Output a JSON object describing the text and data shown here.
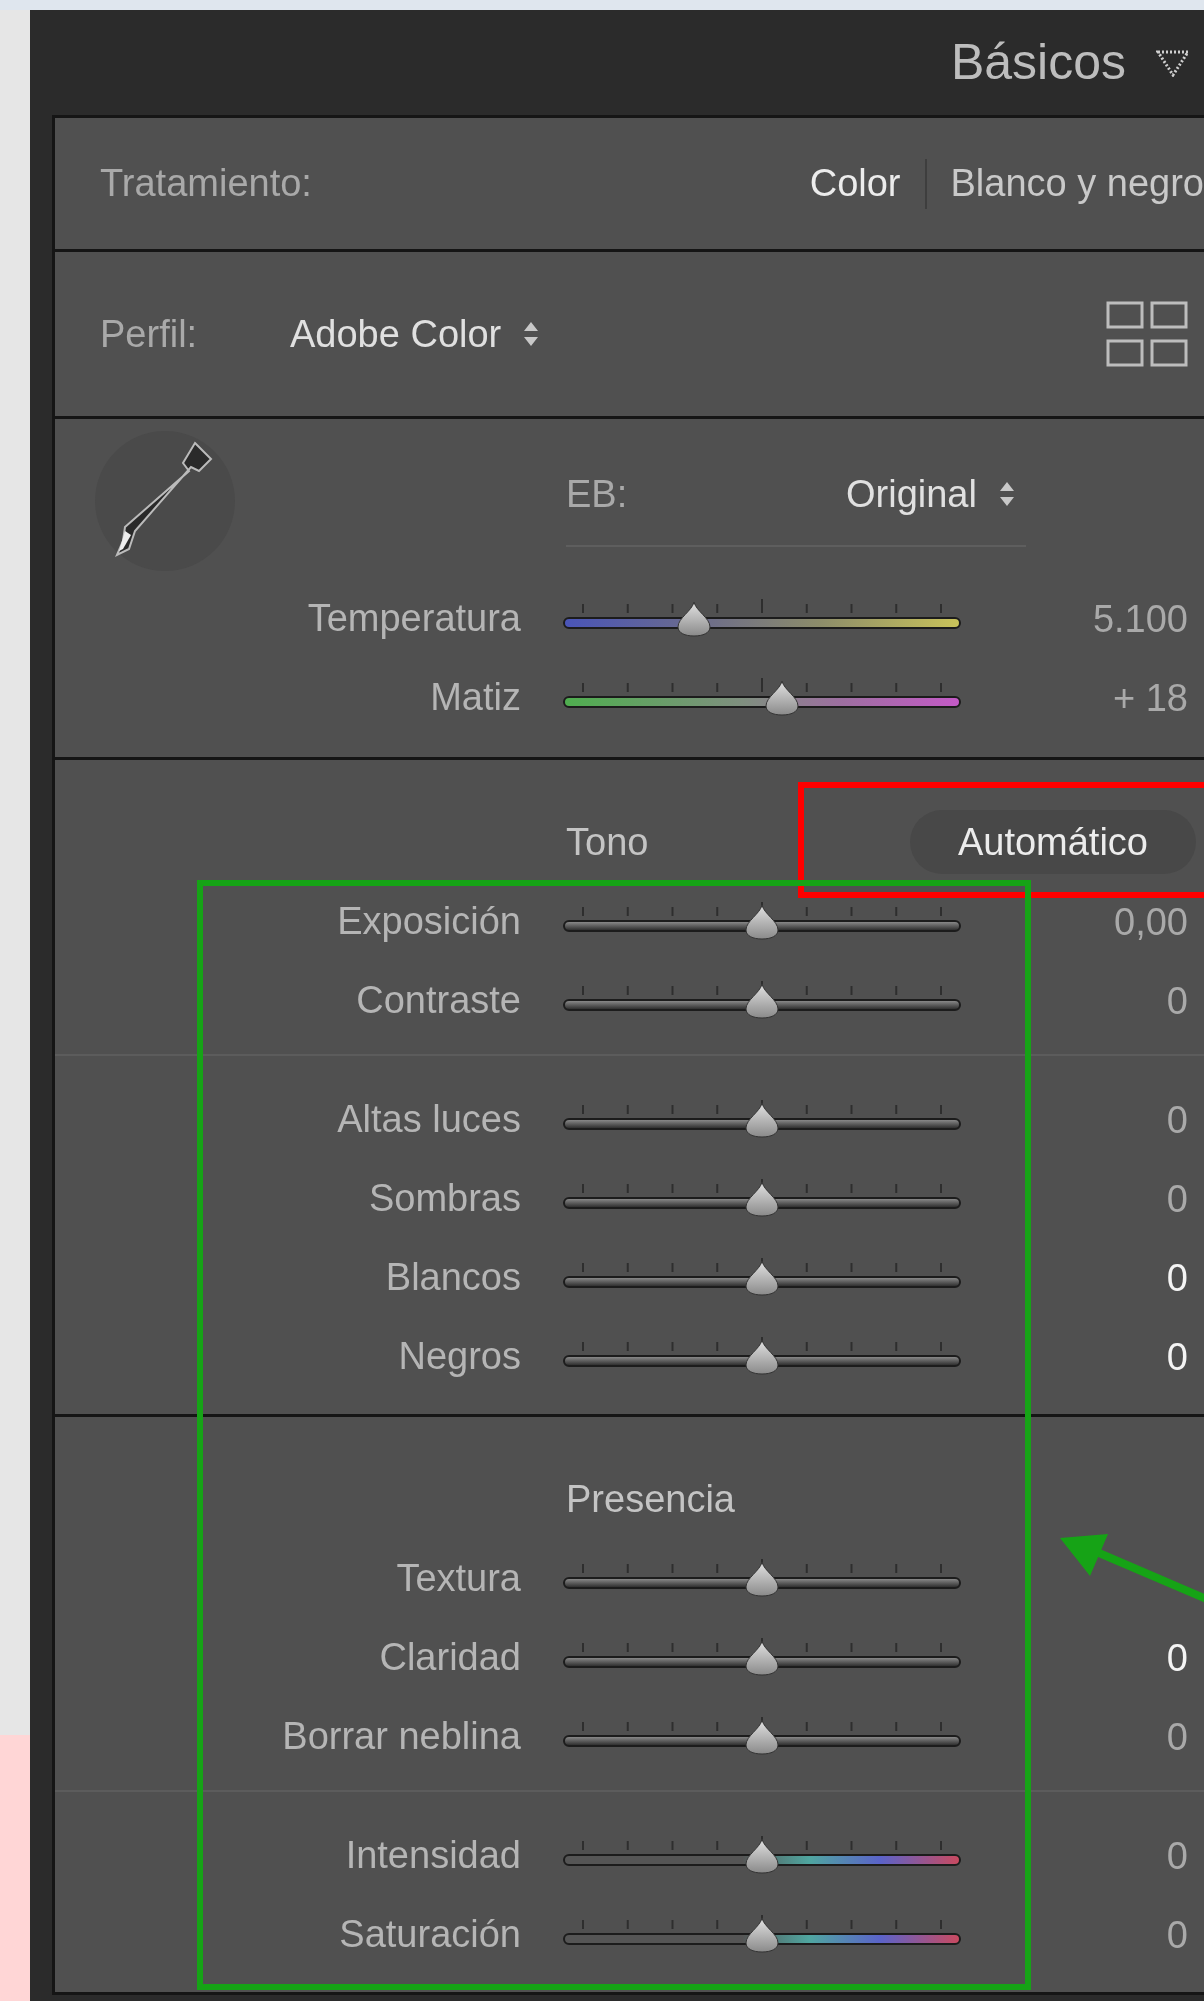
{
  "panel": {
    "title": "Básicos"
  },
  "treatment": {
    "label": "Tratamiento:",
    "options": [
      {
        "label": "Color",
        "selected": true
      },
      {
        "label": "Blanco y negro",
        "selected": false
      }
    ]
  },
  "profile": {
    "label": "Perfil:",
    "value": "Adobe Color"
  },
  "groups": [
    {
      "kind": "wb",
      "label": "EB:",
      "value": "Original",
      "sliders": [
        {
          "name": "Temperatura",
          "kind": "temperature",
          "level": 0.33,
          "reading": "5.100",
          "highlighted": false
        },
        {
          "name": "Matiz",
          "kind": "tint",
          "level": 0.55,
          "reading": "+ 18",
          "highlighted": false
        }
      ]
    },
    {
      "kind": "section",
      "heading": "Tono",
      "button": "Automático",
      "sliders": [
        {
          "name": "Exposición",
          "kind": "neutral",
          "level": 0.5,
          "reading": "0,00",
          "highlighted": false
        },
        {
          "name": "Contraste",
          "kind": "neutral",
          "level": 0.5,
          "reading": "0",
          "highlighted": false
        }
      ]
    },
    {
      "kind": "subsection",
      "sliders": [
        {
          "name": "Altas luces",
          "kind": "neutral",
          "level": 0.5,
          "reading": "0",
          "highlighted": false
        },
        {
          "name": "Sombras",
          "kind": "neutral",
          "level": 0.5,
          "reading": "0",
          "highlighted": false
        },
        {
          "name": "Blancos",
          "kind": "neutral",
          "level": 0.5,
          "reading": "0",
          "highlighted": true
        },
        {
          "name": "Negros",
          "kind": "neutral",
          "level": 0.5,
          "reading": "0",
          "highlighted": true
        }
      ]
    },
    {
      "kind": "section",
      "heading": "Presencia",
      "sliders": [
        {
          "name": "Textura",
          "kind": "neutral",
          "level": 0.5
        },
        {
          "name": "Claridad",
          "kind": "neutral",
          "level": 0.5,
          "reading": "0",
          "highlighted": true
        },
        {
          "name": "Borrar neblina",
          "kind": "neutral",
          "level": 0.5,
          "reading": "0",
          "highlighted": false
        }
      ]
    },
    {
      "kind": "subsection",
      "sliders": [
        {
          "name": "Intensidad",
          "kind": "color",
          "level": 0.5,
          "reading": "0",
          "highlighted": false
        },
        {
          "name": "Saturación",
          "kind": "color",
          "level": 0.5,
          "reading": "0",
          "highlighted": false
        }
      ]
    }
  ],
  "annotations": [
    {
      "kind": "box",
      "color": "#ff0000"
    },
    {
      "kind": "box",
      "color": "#16a316"
    },
    {
      "kind": "arrow",
      "color": "#16a316"
    }
  ]
}
